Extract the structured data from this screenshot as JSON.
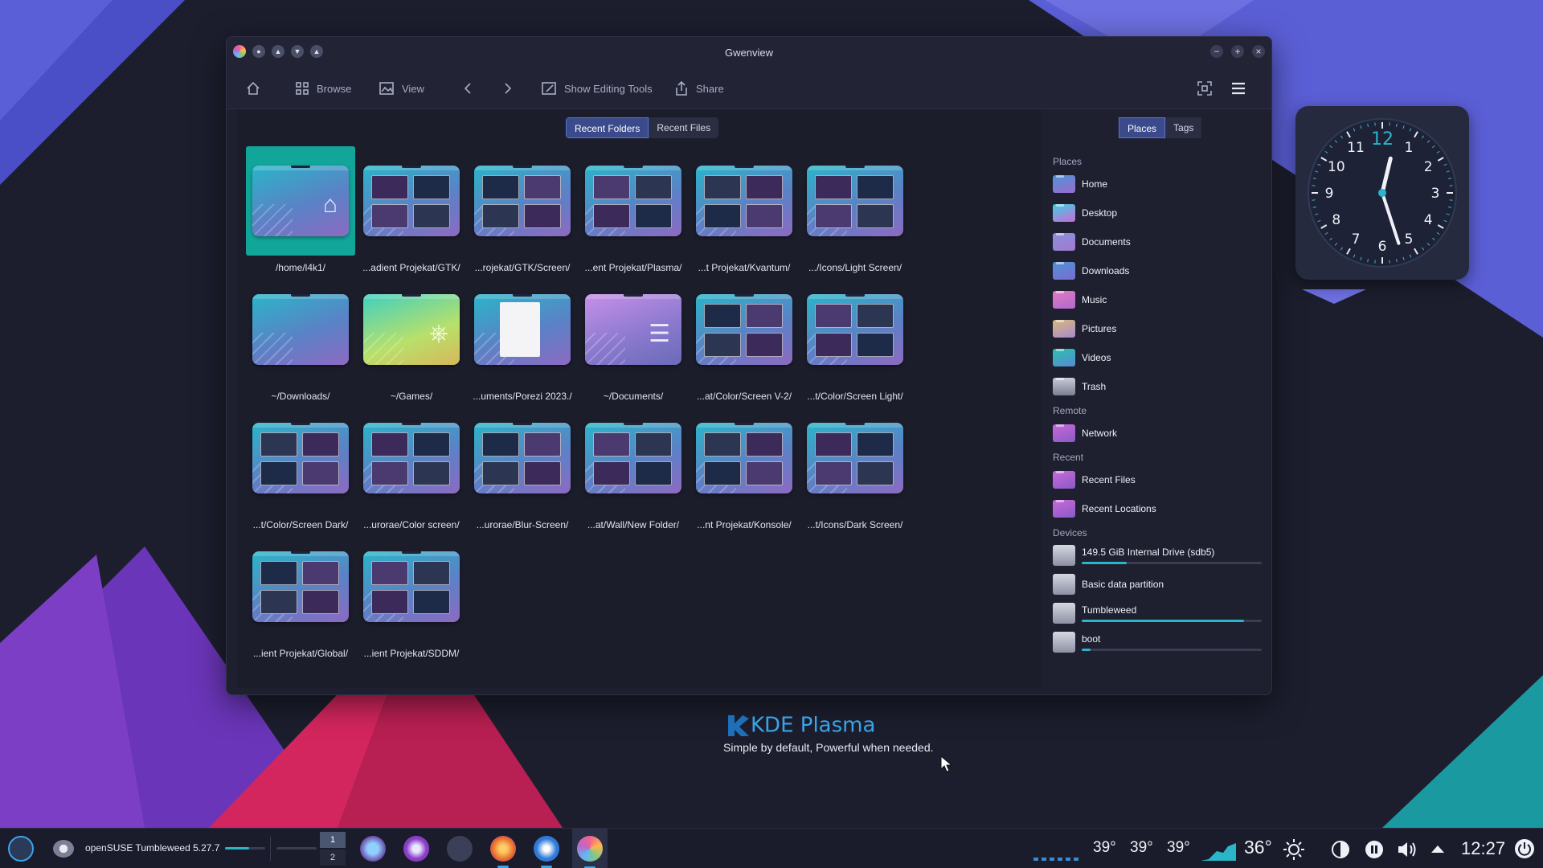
{
  "window": {
    "title": "Gwenview",
    "toolbar": {
      "browse": "Browse",
      "view": "View",
      "show_editing_tools": "Show Editing Tools",
      "share": "Share"
    },
    "tabs": [
      "Recent Folders",
      "Recent Files"
    ],
    "active_tab": "Recent Folders",
    "folders": [
      {
        "label": "/home/l4k1/",
        "kind": "home"
      },
      {
        "label": "...adient Projekat/GTK/",
        "kind": "shots"
      },
      {
        "label": "...rojekat/GTK/Screen/",
        "kind": "shots"
      },
      {
        "label": "...ent Projekat/Plasma/",
        "kind": "shots"
      },
      {
        "label": "...t Projekat/Kvantum/",
        "kind": "shots"
      },
      {
        "label": ".../Icons/Light Screen/",
        "kind": "shots"
      },
      {
        "label": "~/Downloads/",
        "kind": "plain"
      },
      {
        "label": "~/Games/",
        "kind": "games"
      },
      {
        "label": "...uments/Porezi 2023./",
        "kind": "doc"
      },
      {
        "label": "~/Documents/",
        "kind": "documents"
      },
      {
        "label": "...at/Color/Screen V-2/",
        "kind": "shots"
      },
      {
        "label": "...t/Color/Screen Light/",
        "kind": "shots"
      },
      {
        "label": "...t/Color/Screen Dark/",
        "kind": "shots"
      },
      {
        "label": "...urorae/Color screen/",
        "kind": "shots"
      },
      {
        "label": "...urorae/Blur-Screen/",
        "kind": "shots"
      },
      {
        "label": "...at/Wall/New Folder/",
        "kind": "shots"
      },
      {
        "label": "...nt Projekat/Konsole/",
        "kind": "shots"
      },
      {
        "label": "...t/Icons/Dark Screen/",
        "kind": "shots"
      },
      {
        "label": "...ient Projekat/Global/",
        "kind": "shots"
      },
      {
        "label": "...ient Projekat/SDDM/",
        "kind": "shots"
      }
    ],
    "side_tabs": [
      "Places",
      "Tags"
    ],
    "places": {
      "places_header": "Places",
      "places": [
        "Home",
        "Desktop",
        "Documents",
        "Downloads",
        "Music",
        "Pictures",
        "Videos",
        "Trash"
      ],
      "remote_header": "Remote",
      "remote": [
        "Network"
      ],
      "recent_header": "Recent",
      "recent": [
        "Recent Files",
        "Recent Locations"
      ],
      "devices_header": "Devices",
      "devices": [
        {
          "name": "149.5 GiB Internal Drive (sdb5)",
          "usage": 0.25
        },
        {
          "name": "Basic data partition",
          "usage": null
        },
        {
          "name": "Tumbleweed",
          "usage": 0.9
        },
        {
          "name": "boot",
          "usage": 0.05
        }
      ]
    }
  },
  "clock": {
    "hour": 12,
    "minute": 27
  },
  "kde": {
    "title": "KDE Plasma",
    "subtitle": "Simple by default, Powerful when needed."
  },
  "taskbar": {
    "os_label": "openSUSE Tumbleweed 5.27.7",
    "pager": [
      "1",
      "2"
    ],
    "temps": [
      "39°",
      "39°",
      "39°"
    ],
    "weather": "36°",
    "time": "12:27"
  },
  "colors": {
    "accent": "#3aa4e8",
    "selection": "#12a59a",
    "tab_active": "#3a4a8a"
  }
}
